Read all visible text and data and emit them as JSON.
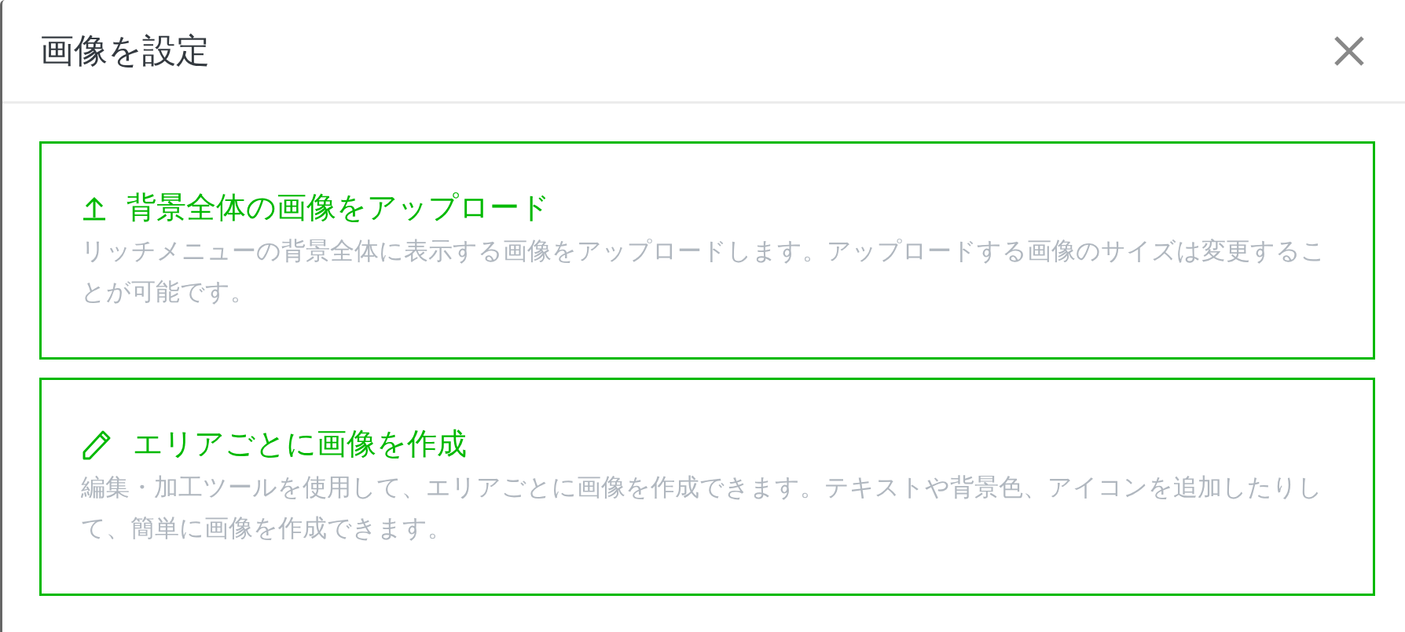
{
  "dialog": {
    "title": "画像を設定"
  },
  "options": [
    {
      "kind": "upload",
      "title": "背景全体の画像をアップロード",
      "description": "リッチメニューの背景全体に表示する画像をアップロードします。アップロードする画像のサイズは変更することが可能です。"
    },
    {
      "kind": "edit",
      "title": "エリアごとに画像を作成",
      "description": "編集・加工ツールを使用して、エリアごとに画像を作成できます。テキストや背景色、アイコンを追加したりして、簡単に画像を作成できます。"
    }
  ]
}
